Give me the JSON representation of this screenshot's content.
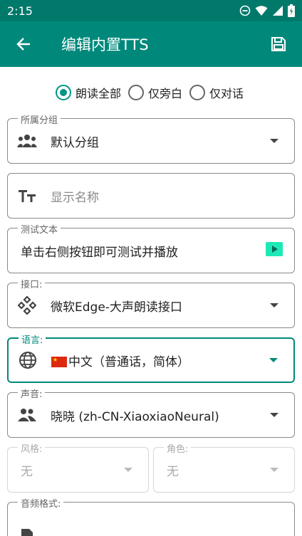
{
  "status": {
    "time": "2:15"
  },
  "appbar": {
    "title": "编辑内置TTS"
  },
  "read_mode": {
    "options": [
      {
        "label": "朗读全部",
        "checked": true
      },
      {
        "label": "仅旁白",
        "checked": false
      },
      {
        "label": "仅对话",
        "checked": false
      }
    ]
  },
  "group": {
    "label": "所属分组",
    "value": "默认分组"
  },
  "display_name": {
    "placeholder": "显示名称"
  },
  "test_text": {
    "label": "测试文本",
    "value": "单击右侧按钮即可测试并播放"
  },
  "api": {
    "label": "接口:",
    "value": "微软Edge-大声朗读接口"
  },
  "language": {
    "label": "语言:",
    "value": "中文（普通话，简体）"
  },
  "voice": {
    "label": "声音:",
    "value": "晓晓 (zh-CN-XiaoxiaoNeural)"
  },
  "style": {
    "label": "风格:",
    "value": "无"
  },
  "role": {
    "label": "角色:",
    "value": "无"
  },
  "audio_format": {
    "label": "音频格式:"
  },
  "colors": {
    "primary": "#00897B",
    "status": "#00796B",
    "accent": "#009688"
  }
}
